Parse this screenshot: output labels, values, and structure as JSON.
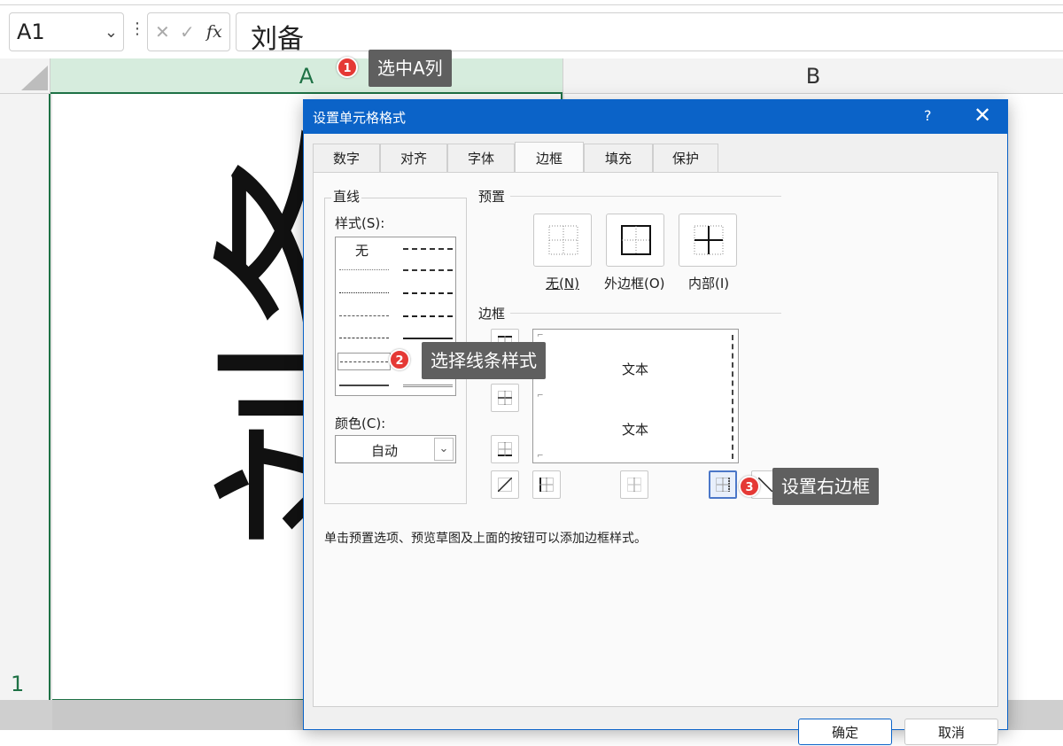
{
  "formula_bar": {
    "name_box": "A1",
    "fx_label": "fx",
    "formula_value": "刘备"
  },
  "grid": {
    "col_a": "A",
    "col_b": "B",
    "row_1": "1",
    "cell_text": "刘备"
  },
  "callouts": [
    {
      "num": "1",
      "text": "选中A列"
    },
    {
      "num": "2",
      "text": "选择线条样式"
    },
    {
      "num": "3",
      "text": "设置右边框"
    }
  ],
  "dialog": {
    "title": "设置单元格格式",
    "help": "?",
    "close": "✕",
    "tabs": [
      "数字",
      "对齐",
      "字体",
      "边框",
      "填充",
      "保护"
    ],
    "active_tab": "边框",
    "line_group": "直线",
    "style_label": "样式(S):",
    "style_none": "无",
    "color_label": "颜色(C):",
    "color_value": "自动",
    "preset_group": "预置",
    "presets": [
      "无(N)",
      "外边框(O)",
      "内部(I)"
    ],
    "border_group": "边框",
    "preview_text": [
      "文本",
      "文本"
    ],
    "note": "单击预置选项、预览草图及上面的按钮可以添加边框样式。",
    "ok": "确定",
    "cancel": "取消"
  }
}
